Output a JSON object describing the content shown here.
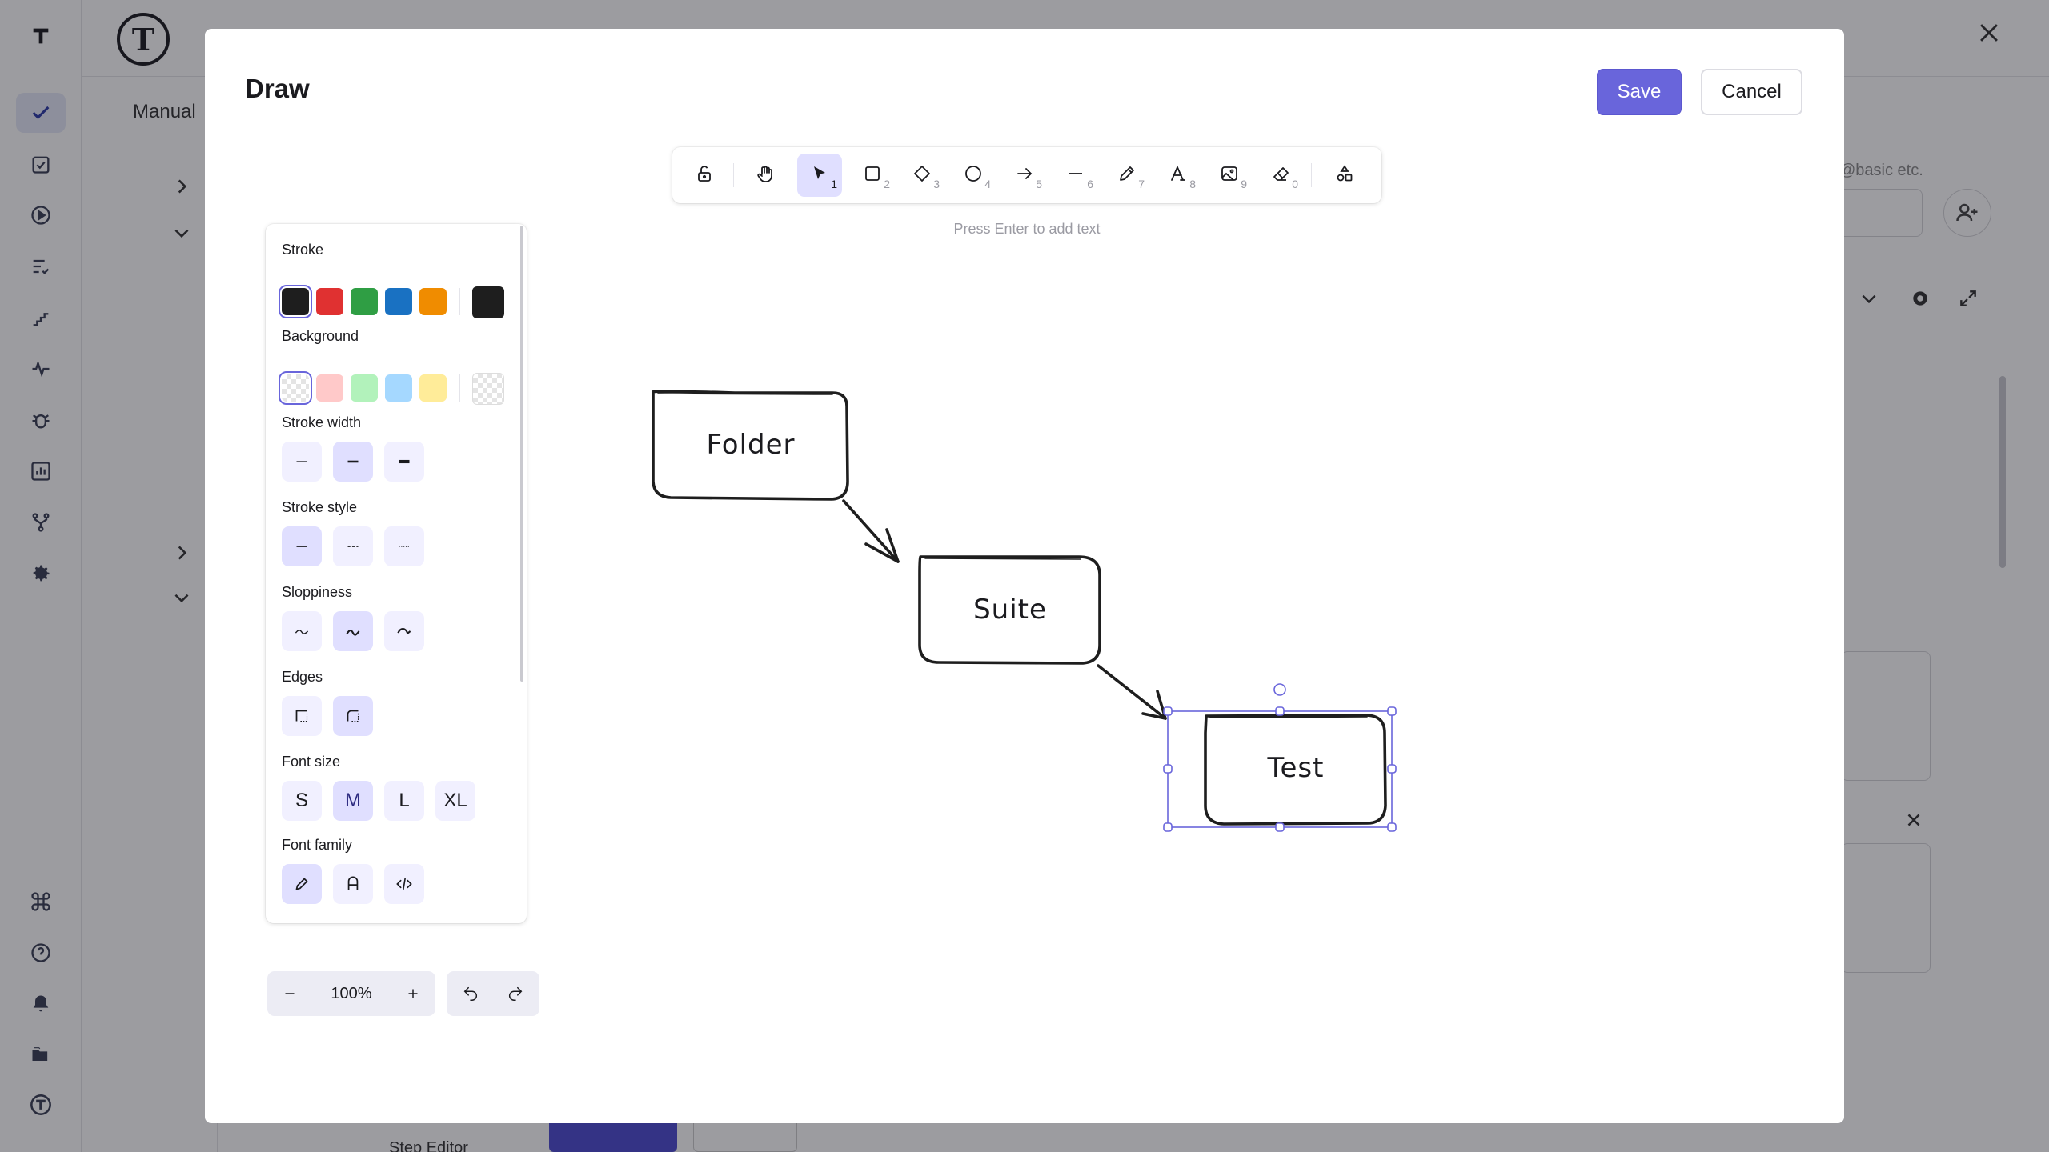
{
  "background": {
    "tab_label": "Manual",
    "rail_icons": [
      "check-icon",
      "clipboard-check-icon",
      "play-circle-icon",
      "list-check-icon",
      "stairs-icon",
      "pulse-icon",
      "bug-icon",
      "bar-chart-icon",
      "git-fork-icon",
      "gear-icon",
      "command-icon",
      "help-circle-icon",
      "bell-icon",
      "folders-icon",
      "logo-icon"
    ],
    "right_hint": "@basic etc.",
    "bottom_item": "Step Editor"
  },
  "modal": {
    "title": "Draw",
    "save_label": "Save",
    "cancel_label": "Cancel"
  },
  "toolbar": {
    "tools": [
      {
        "name": "lock",
        "icon": "unlock-icon",
        "key": ""
      },
      {
        "name": "hand",
        "icon": "hand-icon",
        "key": ""
      },
      {
        "name": "selection",
        "icon": "cursor-icon",
        "key": "1",
        "active": true
      },
      {
        "name": "rectangle",
        "icon": "square-icon",
        "key": "2"
      },
      {
        "name": "diamond",
        "icon": "diamond-icon",
        "key": "3"
      },
      {
        "name": "ellipse",
        "icon": "circle-icon",
        "key": "4"
      },
      {
        "name": "arrow",
        "icon": "arrow-right-icon",
        "key": "5"
      },
      {
        "name": "line",
        "icon": "line-icon",
        "key": "6"
      },
      {
        "name": "draw",
        "icon": "pencil-icon",
        "key": "7"
      },
      {
        "name": "text",
        "icon": "text-icon",
        "key": "8"
      },
      {
        "name": "image",
        "icon": "image-icon",
        "key": "9"
      },
      {
        "name": "eraser",
        "icon": "eraser-icon",
        "key": "0"
      },
      {
        "name": "more-tools",
        "icon": "shapes-icon",
        "key": ""
      }
    ],
    "hint": "Press Enter to add text"
  },
  "properties": {
    "stroke": {
      "label": "Stroke",
      "colors": [
        "#1e1e1e",
        "#e03131",
        "#2f9e44",
        "#1971c2",
        "#f08c00"
      ],
      "selected": "#1e1e1e"
    },
    "background": {
      "label": "Background",
      "colors": [
        "transparent",
        "#ffc9c9",
        "#b2f2bb",
        "#a5d8ff",
        "#ffec99"
      ],
      "selected": "transparent"
    },
    "stroke_width": {
      "label": "Stroke width",
      "options": [
        "thin",
        "bold",
        "extra-bold"
      ],
      "selected": "bold"
    },
    "stroke_style": {
      "label": "Stroke style",
      "options": [
        "solid",
        "dashed",
        "dotted"
      ],
      "selected": "solid"
    },
    "sloppiness": {
      "label": "Sloppiness",
      "options": [
        "architect",
        "artist",
        "cartoonist"
      ],
      "selected": "artist"
    },
    "edges": {
      "label": "Edges",
      "options": [
        "sharp",
        "round"
      ],
      "selected": "round"
    },
    "font_size": {
      "label": "Font size",
      "options": [
        "S",
        "M",
        "L",
        "XL"
      ],
      "selected": "M"
    },
    "font_family": {
      "label": "Font family",
      "options": [
        "hand-drawn",
        "normal",
        "code"
      ],
      "selected": "hand-drawn"
    }
  },
  "zoom": {
    "value": "100%"
  },
  "canvas": {
    "nodes": [
      {
        "label": "Folder"
      },
      {
        "label": "Suite"
      },
      {
        "label": "Test",
        "selected": true
      }
    ]
  },
  "colors": {
    "accent": "#6965db",
    "accent_light": "#e0dfff"
  }
}
